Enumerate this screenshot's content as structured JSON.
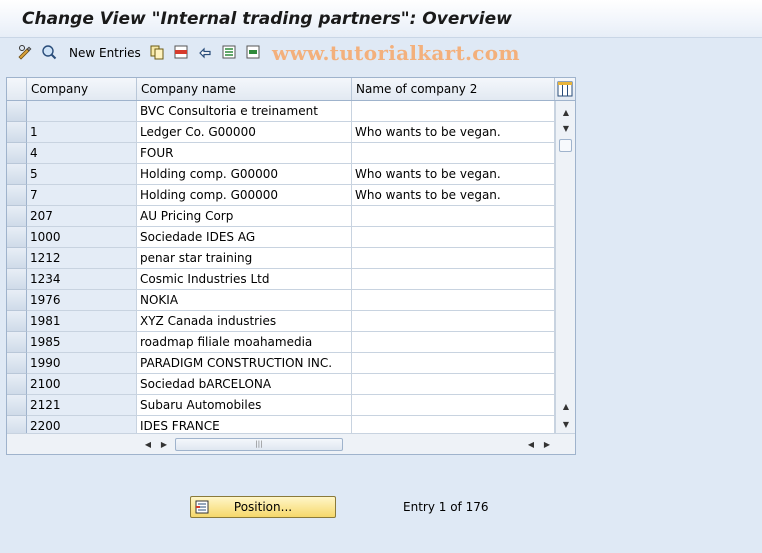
{
  "title": "Change View \"Internal trading partners\": Overview",
  "toolbar": {
    "new_entries_label": "New Entries",
    "watermark": "www.tutorialkart.com",
    "icons": [
      "display-change-icon",
      "details-icon",
      "copy-icon",
      "delete-icon",
      "undo-icon",
      "select-all-icon",
      "select-block-icon"
    ]
  },
  "table": {
    "columns": [
      "Company",
      "Company name",
      "Name of company 2"
    ],
    "rows": [
      {
        "company": "",
        "name": "BVC Consultoria e treinament",
        "name2": ""
      },
      {
        "company": "1",
        "name": "Ledger Co. G00000",
        "name2": "Who wants to be vegan."
      },
      {
        "company": "4",
        "name": "FOUR",
        "name2": ""
      },
      {
        "company": "5",
        "name": "Holding comp. G00000",
        "name2": "Who wants to be vegan."
      },
      {
        "company": "7",
        "name": "Holding comp. G00000",
        "name2": "Who wants to be vegan."
      },
      {
        "company": "207",
        "name": "AU Pricing Corp",
        "name2": ""
      },
      {
        "company": "1000",
        "name": "Sociedade IDES AG",
        "name2": ""
      },
      {
        "company": "1212",
        "name": "penar star training",
        "name2": ""
      },
      {
        "company": "1234",
        "name": "Cosmic Industries Ltd",
        "name2": ""
      },
      {
        "company": "1976",
        "name": "NOKIA",
        "name2": ""
      },
      {
        "company": "1981",
        "name": "XYZ Canada industries",
        "name2": ""
      },
      {
        "company": "1985",
        "name": "roadmap filiale moahamedia",
        "name2": ""
      },
      {
        "company": "1990",
        "name": "PARADIGM CONSTRUCTION INC.",
        "name2": ""
      },
      {
        "company": "2100",
        "name": "Sociedad bARCELONA",
        "name2": ""
      },
      {
        "company": "2121",
        "name": "Subaru Automobiles",
        "name2": ""
      },
      {
        "company": "2200",
        "name": "IDES FRANCE",
        "name2": ""
      }
    ]
  },
  "footer": {
    "position_label": "Position...",
    "entry_info": "Entry 1 of 176"
  },
  "colors": {
    "background": "#dfe9f5",
    "key_column": "#e4ecf6",
    "watermark": "#f3b07c",
    "button": "#f6d86b"
  }
}
